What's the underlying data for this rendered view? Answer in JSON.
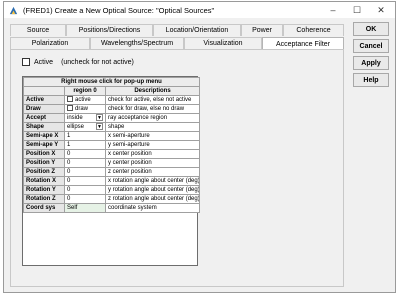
{
  "window": {
    "title": "(FRED1) Create a New Optical Source: \"Optical Sources\"",
    "controls": [
      "–",
      "☐",
      "✕"
    ]
  },
  "tabs_row1": [
    "Source",
    "Positions/Directions",
    "Location/Orientation",
    "Power",
    "Coherence"
  ],
  "tabs_row2": [
    "Polarization",
    "Wavelengths/Spectrum",
    "Visualization",
    "Acceptance Filter"
  ],
  "active_checkbox": {
    "label": "Active",
    "hint": "(uncheck for not active)"
  },
  "grid": {
    "title": "Right mouse click for pop-up menu",
    "header": [
      "",
      "region 0",
      "Descriptions"
    ],
    "rows": [
      {
        "label": "Active",
        "value": "active",
        "desc": "check for active, else not active"
      },
      {
        "label": "Draw",
        "value": "draw",
        "desc": "check for draw, else no draw"
      },
      {
        "label": "Accept",
        "value": "inside",
        "desc": "ray acceptance region"
      },
      {
        "label": "Shape",
        "value": "ellipse",
        "desc": "shape"
      },
      {
        "label": "Semi-ape X",
        "value": "1",
        "desc": "x semi-aperture"
      },
      {
        "label": "Semi-ape Y",
        "value": "1",
        "desc": "y semi-aperture"
      },
      {
        "label": "Position X",
        "value": "0",
        "desc": "x center position"
      },
      {
        "label": "Position Y",
        "value": "0",
        "desc": "y center position"
      },
      {
        "label": "Position Z",
        "value": "0",
        "desc": "z center position"
      },
      {
        "label": "Rotation X",
        "value": "0",
        "desc": "x rotation angle about center (deg)"
      },
      {
        "label": "Rotation Y",
        "value": "0",
        "desc": "y rotation angle about center (deg)"
      },
      {
        "label": "Rotation Z",
        "value": "0",
        "desc": "z rotation angle about center (deg)"
      },
      {
        "label": "Coord sys",
        "value": "Self",
        "desc": "coordinate system"
      }
    ]
  },
  "buttons": {
    "ok": "OK",
    "cancel": "Cancel",
    "apply": "Apply",
    "help": "Help"
  }
}
